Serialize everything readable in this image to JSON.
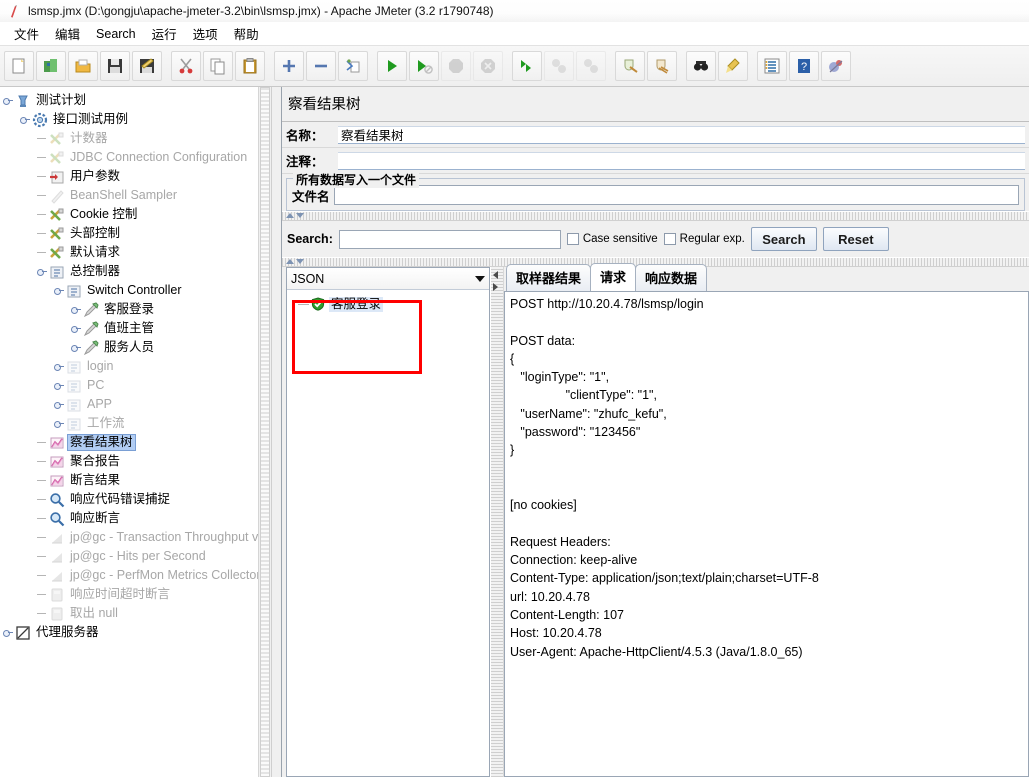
{
  "window": {
    "title": "lsmsp.jmx (D:\\gongju\\apache-jmeter-3.2\\bin\\lsmsp.jmx) - Apache JMeter (3.2 r1790748)",
    "app_icon": "jmeter-icon"
  },
  "menubar": {
    "items": [
      {
        "label": "文件",
        "name": "menu-file"
      },
      {
        "label": "编辑",
        "name": "menu-edit"
      },
      {
        "label": "Search",
        "name": "menu-search"
      },
      {
        "label": "运行",
        "name": "menu-run"
      },
      {
        "label": "选项",
        "name": "menu-options"
      },
      {
        "label": "帮助",
        "name": "menu-help"
      }
    ]
  },
  "toolbar": {
    "buttons": [
      {
        "name": "new-button",
        "icon": "new-document-icon",
        "disabled": false
      },
      {
        "name": "templates-button",
        "icon": "templates-icon",
        "disabled": false
      },
      {
        "name": "open-button",
        "icon": "open-folder-icon",
        "disabled": false
      },
      {
        "name": "save-button",
        "icon": "save-disk-icon",
        "disabled": false
      },
      {
        "name": "save-as-button",
        "icon": "save-as-icon",
        "disabled": false
      },
      {
        "name": "separator-1",
        "icon": "separator",
        "disabled": false
      },
      {
        "name": "cut-button",
        "icon": "scissors-icon",
        "disabled": false
      },
      {
        "name": "copy-button",
        "icon": "copy-icon",
        "disabled": false
      },
      {
        "name": "paste-button",
        "icon": "clipboard-paste-icon",
        "disabled": false
      },
      {
        "name": "separator-2",
        "icon": "separator",
        "disabled": false
      },
      {
        "name": "expand-all-button",
        "icon": "plus-icon",
        "disabled": false
      },
      {
        "name": "collapse-all-button",
        "icon": "minus-icon",
        "disabled": false
      },
      {
        "name": "toggle-button",
        "icon": "toggle-icon",
        "disabled": false
      },
      {
        "name": "separator-3",
        "icon": "separator",
        "disabled": false
      },
      {
        "name": "start-button",
        "icon": "play-green-icon",
        "disabled": false
      },
      {
        "name": "start-no-timers-button",
        "icon": "play-no-timers-icon",
        "disabled": false
      },
      {
        "name": "stop-button",
        "icon": "stop-octagon-icon",
        "disabled": true
      },
      {
        "name": "shutdown-button",
        "icon": "shutdown-icon",
        "disabled": true
      },
      {
        "name": "separator-4",
        "icon": "separator",
        "disabled": false
      },
      {
        "name": "start-remote-button",
        "icon": "remote-start-icon",
        "disabled": false
      },
      {
        "name": "stop-remote-button",
        "icon": "remote-stop-icon",
        "disabled": true
      },
      {
        "name": "shutdown-remote-button",
        "icon": "remote-shutdown-icon",
        "disabled": true
      },
      {
        "name": "separator-5",
        "icon": "separator",
        "disabled": false
      },
      {
        "name": "clear-button",
        "icon": "clear-broom-icon",
        "disabled": false
      },
      {
        "name": "clear-all-button",
        "icon": "clear-all-icon",
        "disabled": false
      },
      {
        "name": "separator-6",
        "icon": "separator",
        "disabled": false
      },
      {
        "name": "search-button",
        "icon": "binoculars-icon",
        "disabled": false
      },
      {
        "name": "search-reset-button",
        "icon": "brush-icon",
        "disabled": false
      },
      {
        "name": "separator-7",
        "icon": "separator",
        "disabled": false
      },
      {
        "name": "function-helper-button",
        "icon": "function-list-icon",
        "disabled": false
      },
      {
        "name": "help-button",
        "icon": "help-book-icon",
        "disabled": false
      },
      {
        "name": "undo-redo-button",
        "icon": "misc-icon",
        "disabled": false
      }
    ]
  },
  "tree": {
    "nodes": [
      {
        "label": "测试计划",
        "indent": 0,
        "icon": "test-plan-icon",
        "handle": "exp",
        "dim": false,
        "selected": false
      },
      {
        "label": "接口测试用例",
        "indent": 1,
        "icon": "thread-group-icon",
        "handle": "exp",
        "dim": false,
        "selected": false
      },
      {
        "label": "计数器",
        "indent": 2,
        "icon": "config-gear-icon",
        "handle": "leaf",
        "dim": true,
        "selected": false
      },
      {
        "label": "JDBC Connection Configuration",
        "indent": 2,
        "icon": "config-gear-icon",
        "handle": "leaf",
        "dim": true,
        "selected": false
      },
      {
        "label": "用户参数",
        "indent": 2,
        "icon": "user-params-icon",
        "handle": "leaf",
        "dim": false,
        "selected": false
      },
      {
        "label": "BeanShell Sampler",
        "indent": 2,
        "icon": "sampler-icon",
        "handle": "leaf",
        "dim": true,
        "selected": false
      },
      {
        "label": "Cookie 控制",
        "indent": 2,
        "icon": "config-gear-icon",
        "handle": "leaf",
        "dim": false,
        "selected": false
      },
      {
        "label": "头部控制",
        "indent": 2,
        "icon": "config-gear-icon",
        "handle": "leaf",
        "dim": false,
        "selected": false
      },
      {
        "label": "默认请求",
        "indent": 2,
        "icon": "config-gear-icon",
        "handle": "leaf",
        "dim": false,
        "selected": false
      },
      {
        "label": "总控制器",
        "indent": 2,
        "icon": "controller-icon",
        "handle": "exp",
        "dim": false,
        "selected": false
      },
      {
        "label": "Switch Controller",
        "indent": 3,
        "icon": "controller-icon",
        "handle": "exp",
        "dim": false,
        "selected": false
      },
      {
        "label": "客服登录",
        "indent": 4,
        "icon": "sampler-pen-icon",
        "handle": "exp",
        "dim": false,
        "selected": false
      },
      {
        "label": "值班主管",
        "indent": 4,
        "icon": "sampler-pen-icon",
        "handle": "exp",
        "dim": false,
        "selected": false
      },
      {
        "label": "服务人员",
        "indent": 4,
        "icon": "sampler-pen-icon",
        "handle": "exp",
        "dim": false,
        "selected": false
      },
      {
        "label": "login",
        "indent": 3,
        "icon": "controller-icon",
        "handle": "exp",
        "dim": true,
        "selected": false
      },
      {
        "label": "PC",
        "indent": 3,
        "icon": "controller-icon",
        "handle": "exp",
        "dim": true,
        "selected": false
      },
      {
        "label": "APP",
        "indent": 3,
        "icon": "controller-icon",
        "handle": "exp",
        "dim": true,
        "selected": false
      },
      {
        "label": "工作流",
        "indent": 3,
        "icon": "controller-icon",
        "handle": "exp",
        "dim": true,
        "selected": false
      },
      {
        "label": "察看结果树",
        "indent": 2,
        "icon": "listener-chart-icon",
        "handle": "leaf",
        "dim": false,
        "selected": true
      },
      {
        "label": "聚合报告",
        "indent": 2,
        "icon": "listener-chart-icon",
        "handle": "leaf",
        "dim": false,
        "selected": false
      },
      {
        "label": "断言结果",
        "indent": 2,
        "icon": "listener-chart-icon",
        "handle": "leaf",
        "dim": false,
        "selected": false
      },
      {
        "label": "响应代码错误捕捉",
        "indent": 2,
        "icon": "magnifier-icon",
        "handle": "leaf",
        "dim": false,
        "selected": false
      },
      {
        "label": "响应断言",
        "indent": 2,
        "icon": "magnifier-icon",
        "handle": "leaf",
        "dim": false,
        "selected": false
      },
      {
        "label": "jp@gc - Transaction Throughput vs",
        "indent": 2,
        "icon": "graph-icon",
        "handle": "leaf",
        "dim": true,
        "selected": false
      },
      {
        "label": "jp@gc - Hits per Second",
        "indent": 2,
        "icon": "graph-icon",
        "handle": "leaf",
        "dim": true,
        "selected": false
      },
      {
        "label": "jp@gc - PerfMon Metrics Collector",
        "indent": 2,
        "icon": "graph-icon",
        "handle": "leaf",
        "dim": true,
        "selected": false
      },
      {
        "label": "响应时间超时断言",
        "indent": 2,
        "icon": "assertion-icon",
        "handle": "leaf",
        "dim": true,
        "selected": false
      },
      {
        "label": "取出 null",
        "indent": 2,
        "icon": "assertion-icon",
        "handle": "leaf",
        "dim": true,
        "selected": false
      },
      {
        "label": "代理服务器",
        "indent": 0,
        "icon": "workbench-icon",
        "handle": "exp",
        "dim": false,
        "selected": false
      }
    ]
  },
  "panel": {
    "title": "察看结果树",
    "name_label": "名称：",
    "name_value": "察看结果树",
    "comment_label": "注释：",
    "comment_value": "",
    "group_title": "所有数据写入一个文件",
    "filename_label": "文件名",
    "filename_value": ""
  },
  "search": {
    "label": "Search:",
    "value": "",
    "case_sensitive_label": "Case sensitive",
    "case_sensitive_checked": false,
    "regular_exp_label": "Regular exp.",
    "regular_exp_checked": false,
    "search_button": "Search",
    "reset_button": "Reset"
  },
  "results": {
    "renderer_selected": "JSON",
    "items": [
      {
        "label": "客服登录",
        "status": "success",
        "status_color": "#2f9e2f"
      }
    ]
  },
  "detail": {
    "tabs": [
      {
        "label": "取样器结果",
        "active": false,
        "name": "tab-sampler-result"
      },
      {
        "label": "请求",
        "active": true,
        "name": "tab-request"
      },
      {
        "label": "响应数据",
        "active": false,
        "name": "tab-response-data"
      }
    ],
    "request_text": "POST http://10.20.4.78/lsmsp/login\n\nPOST data:\n{\n   \"loginType\": \"1\",\n                \"clientType\": \"1\",\n   \"userName\": \"zhufc_kefu\",\n   \"password\": \"123456\"\n}\n\n\n[no cookies]\n\nRequest Headers:\nConnection: keep-alive\nContent-Type: application/json;text/plain;charset=UTF-8\nurl: 10.20.4.78\nContent-Length: 107\nHost: 10.20.4.78\nUser-Agent: Apache-HttpClient/4.5.3 (Java/1.8.0_65)"
  },
  "annotation": {
    "color": "#ff0000",
    "name": "red-highlight-box"
  }
}
